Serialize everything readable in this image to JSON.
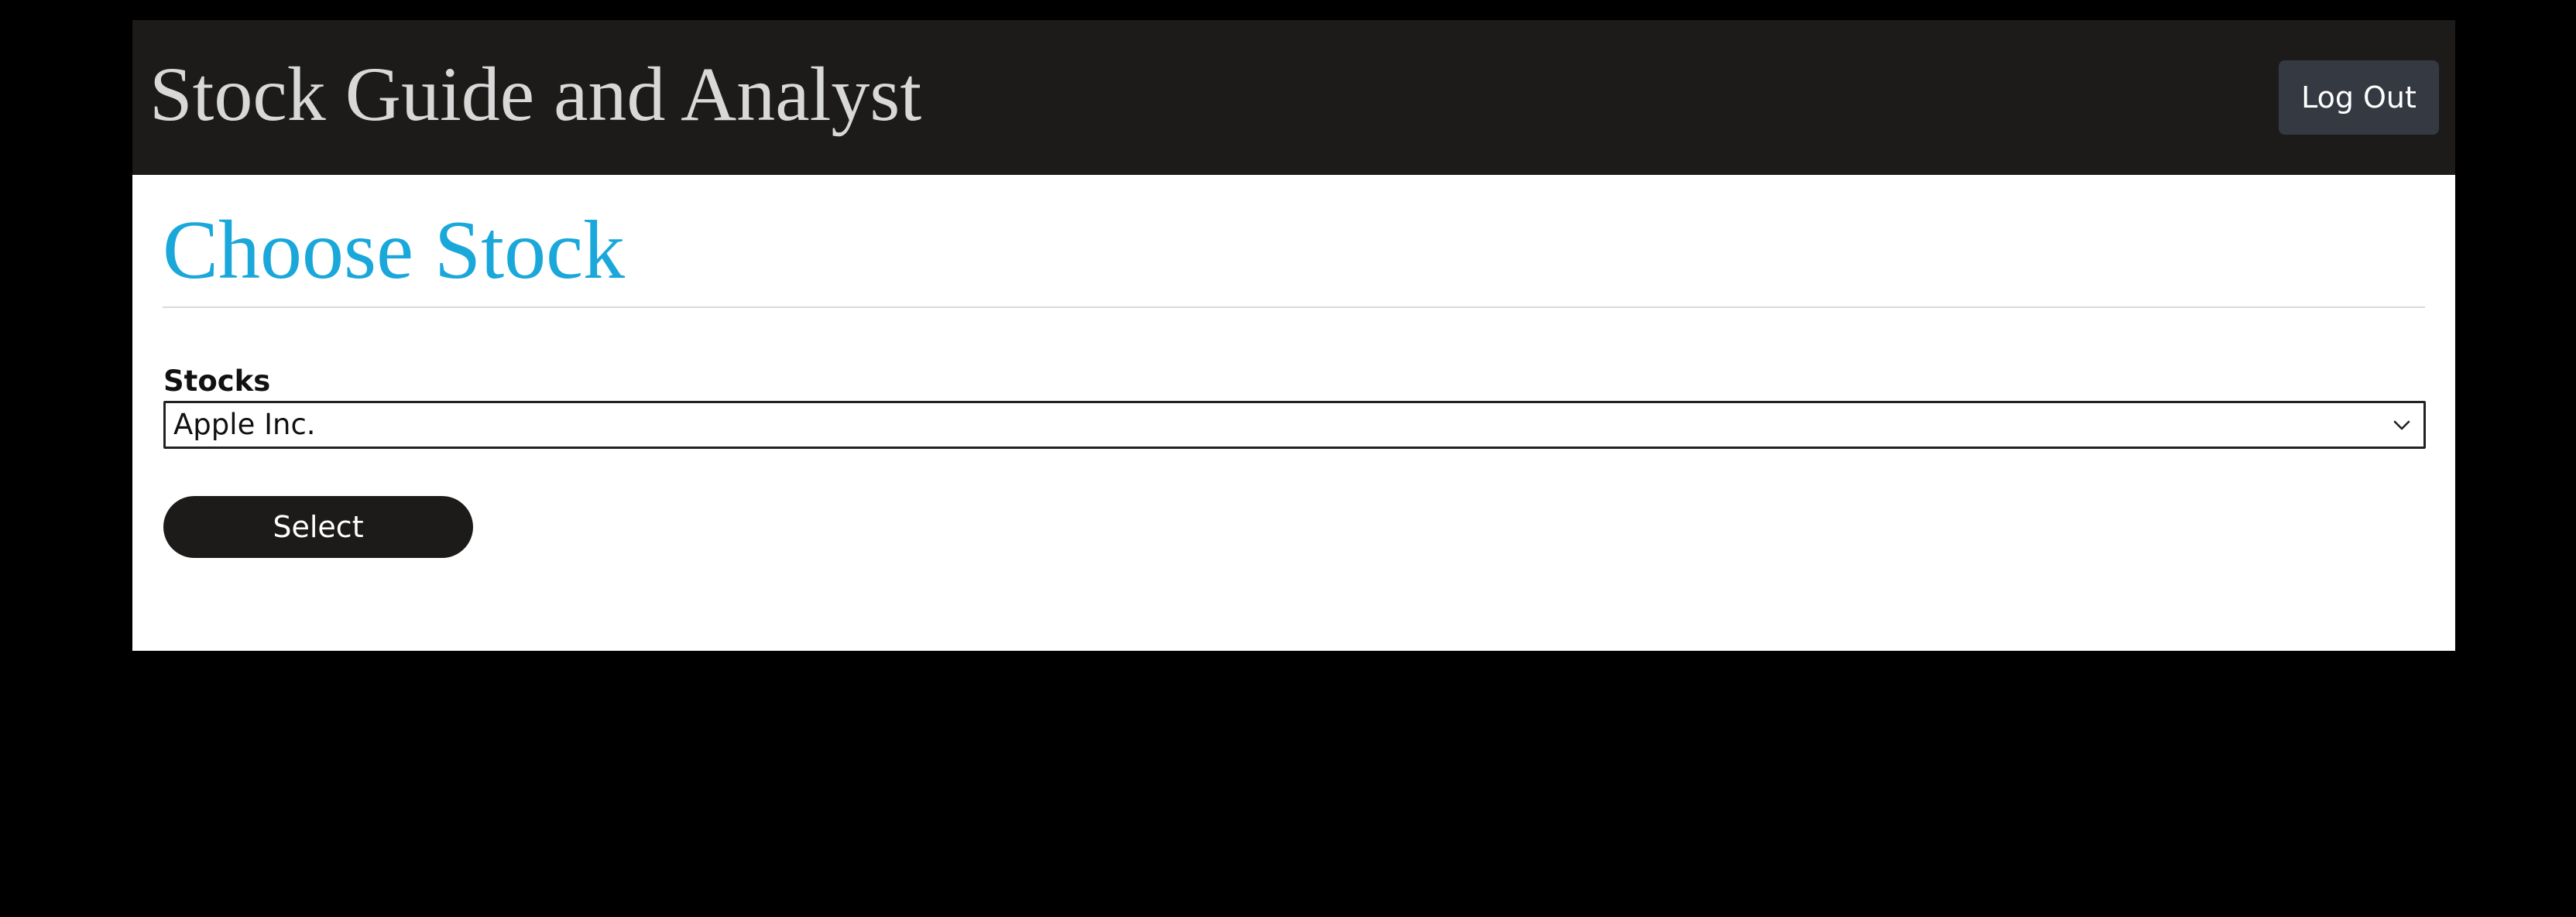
{
  "header": {
    "app_title": "Stock Guide and Analyst",
    "logout_label": "Log Out"
  },
  "main": {
    "page_title": "Choose Stock",
    "stocks_label": "Stocks",
    "selected_stock": "Apple Inc.",
    "select_button_label": "Select"
  },
  "icons": {
    "dropdown": "chevron-down-icon"
  },
  "colors": {
    "page_background": "#000000",
    "header_background": "#1c1b1a",
    "title_accent": "#1aa7da",
    "logout_button": "#353a42",
    "primary_button": "#1c1b1a"
  }
}
